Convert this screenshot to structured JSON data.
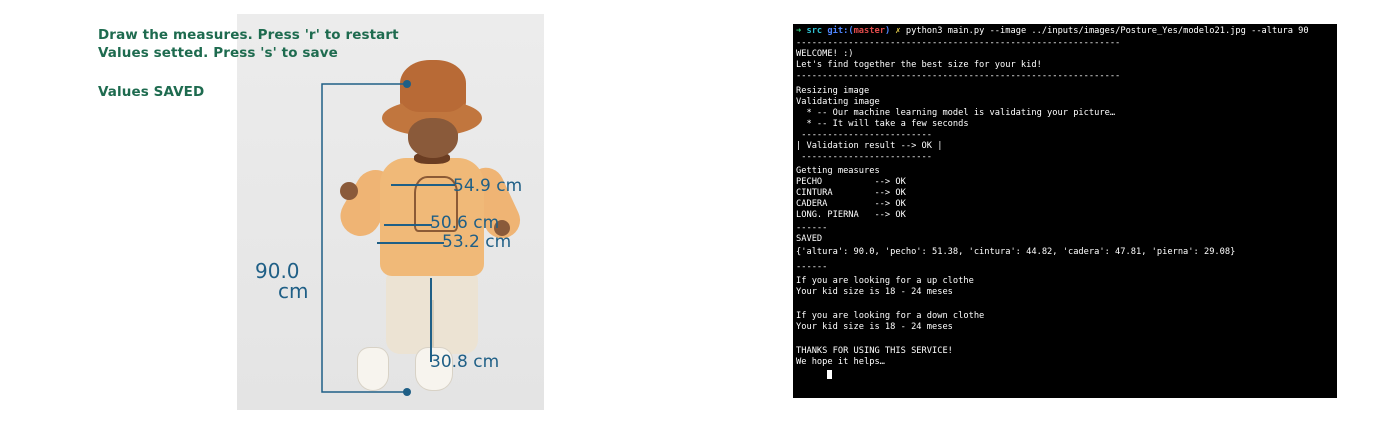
{
  "measure_app": {
    "instruction_1": "Draw the measures. Press 'r' to restart",
    "instruction_2": "Values setted. Press 's' to save",
    "status": "Values SAVED",
    "measurements": {
      "chest": "54.9 cm",
      "waist": "50.6 cm",
      "hip": "53.2 cm",
      "leg": "30.8 cm",
      "height_value": "90.0",
      "height_unit": "cm"
    },
    "colors": {
      "overlay_text": "#1e6b4f",
      "measure_line": "#1f5f86"
    }
  },
  "terminal": {
    "prompt": {
      "arrow": "➜",
      "dir": "src",
      "git": "git:(",
      "branch": "master",
      "git_close": ")",
      "dirty": "✗",
      "command": "python3 main.py --image ../inputs/images/Posture_Yes/modelo21.jpg --altura 90"
    },
    "lines": [
      "--------------------------------------------------------------",
      "WELCOME! :)",
      "Let's find together the best size for your kid!",
      "--------------------------------------------------------------",
      "Resizing image",
      "Validating image",
      "  * -- Our machine learning model is validating your picture…",
      "  * -- It will take a few seconds",
      " -------------------------",
      "| Validation result --> OK |",
      " -------------------------",
      "Getting measures",
      "PECHO          --> OK",
      "CINTURA        --> OK",
      "CADERA         --> OK",
      "LONG. PIERNA   --> OK",
      "------",
      "SAVED",
      "{'altura': 90.0, 'pecho': 51.38, 'cintura': 44.82, 'cadera': 47.81, 'pierna': 29.08}",
      "------",
      "If you are looking for a up clothe",
      "Your kid size is 18 - 24 meses",
      "",
      "If you are looking for a down clothe",
      "Your kid size is 18 - 24 meses",
      "",
      "THANKS FOR USING THIS SERVICE!",
      "We hope it helps…"
    ]
  }
}
